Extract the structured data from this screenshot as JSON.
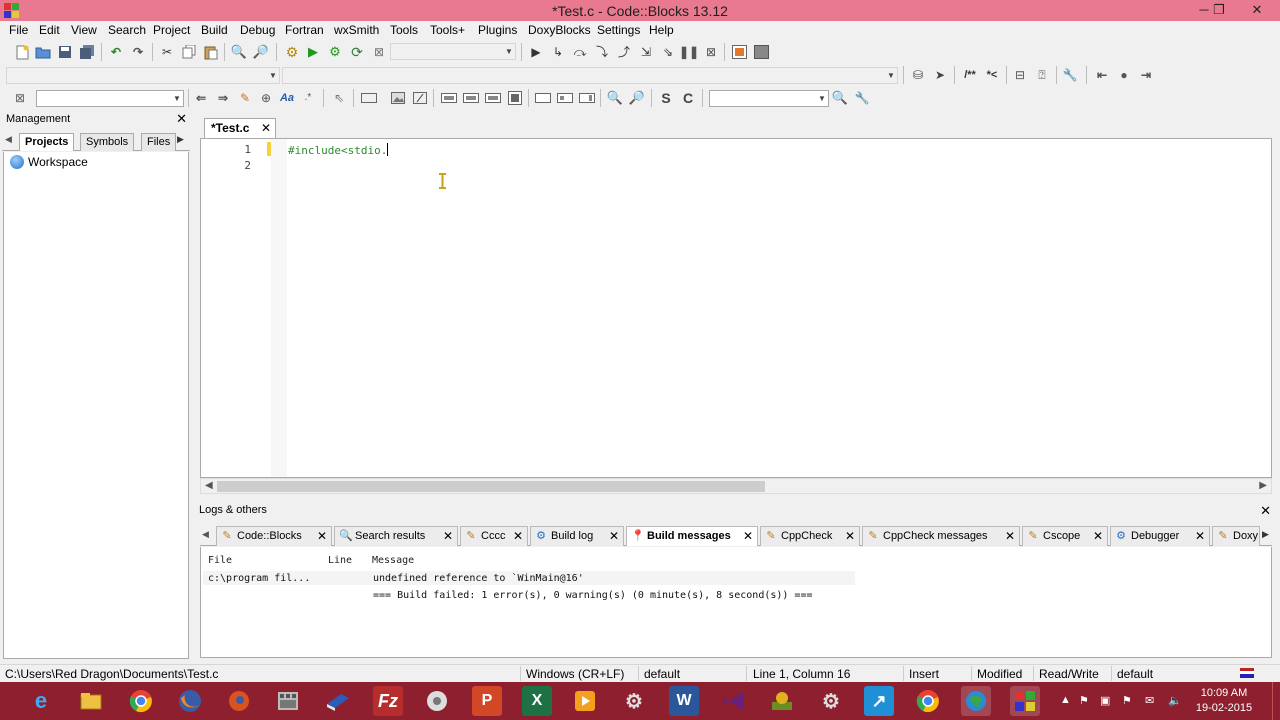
{
  "window": {
    "title": "*Test.c - Code::Blocks 13.12",
    "minimize": "─",
    "restore": "❐",
    "close": "✕"
  },
  "menu": [
    "File",
    "Edit",
    "View",
    "Search",
    "Project",
    "Build",
    "Debug",
    "Fortran",
    "wxSmith",
    "Tools",
    "Tools+",
    "Plugins",
    "DoxyBlocks",
    "Settings",
    "Help"
  ],
  "toolbar": {
    "doc_comment_label": "/**",
    "line_comment_label": "*<"
  },
  "management": {
    "title": "Management",
    "tabs": [
      "Projects",
      "Symbols",
      "Files"
    ],
    "active_tab": "Projects",
    "tree_root": "Workspace"
  },
  "editor": {
    "tab_label": "*Test.c",
    "line_numbers": [
      "1",
      "2"
    ],
    "code_line_1": "#include<stdio."
  },
  "logs": {
    "title": "Logs & others",
    "tabs": [
      {
        "label": "Code::Blocks",
        "icon": "pencil-icon"
      },
      {
        "label": "Search results",
        "icon": "magnifier-icon"
      },
      {
        "label": "Cccc",
        "icon": "pencil-icon"
      },
      {
        "label": "Build log",
        "icon": "gear-icon"
      },
      {
        "label": "Build messages",
        "icon": "pin-icon"
      },
      {
        "label": "CppCheck",
        "icon": "pencil-icon"
      },
      {
        "label": "CppCheck messages",
        "icon": "pencil-icon"
      },
      {
        "label": "Cscope",
        "icon": "pencil-icon"
      },
      {
        "label": "Debugger",
        "icon": "gear-icon"
      },
      {
        "label": "Doxy",
        "icon": "pencil-icon"
      }
    ],
    "active_tab": "Build messages",
    "columns": [
      "File",
      "Line",
      "Message"
    ],
    "rows": [
      {
        "file": "c:\\program fil...",
        "line": "",
        "message": "undefined reference to `WinMain@16'"
      },
      {
        "file": "",
        "line": "",
        "message": "=== Build failed: 1 error(s), 0 warning(s) (0 minute(s), 8 second(s)) ==="
      }
    ]
  },
  "statusbar": {
    "path": "C:\\Users\\Red Dragon\\Documents\\Test.c",
    "eol": "Windows (CR+LF)",
    "encoding": "default",
    "position": "Line 1, Column 16",
    "mode": "Insert",
    "modified": "Modified",
    "access": "Read/Write",
    "profile": "default"
  },
  "taskbar": {
    "time": "10:09 AM",
    "date": "19-02-2015",
    "items": [
      "internet-explorer",
      "file-explorer",
      "chrome",
      "firefox",
      "firefox-dev",
      "media-app",
      "visual-studio-book",
      "filezilla",
      "tool-app",
      "powerpoint",
      "excel",
      "media-player",
      "utility",
      "word",
      "visual-studio",
      "codeblocks-gear",
      "calculator",
      "arrow-app",
      "chrome",
      "globe-app",
      "codeblocks"
    ]
  },
  "colors": {
    "titlebar": "#e9798f",
    "taskbar": "#8e1f2f",
    "code_green": "#2e8b2e",
    "modified_marker": "#f6d33a"
  }
}
